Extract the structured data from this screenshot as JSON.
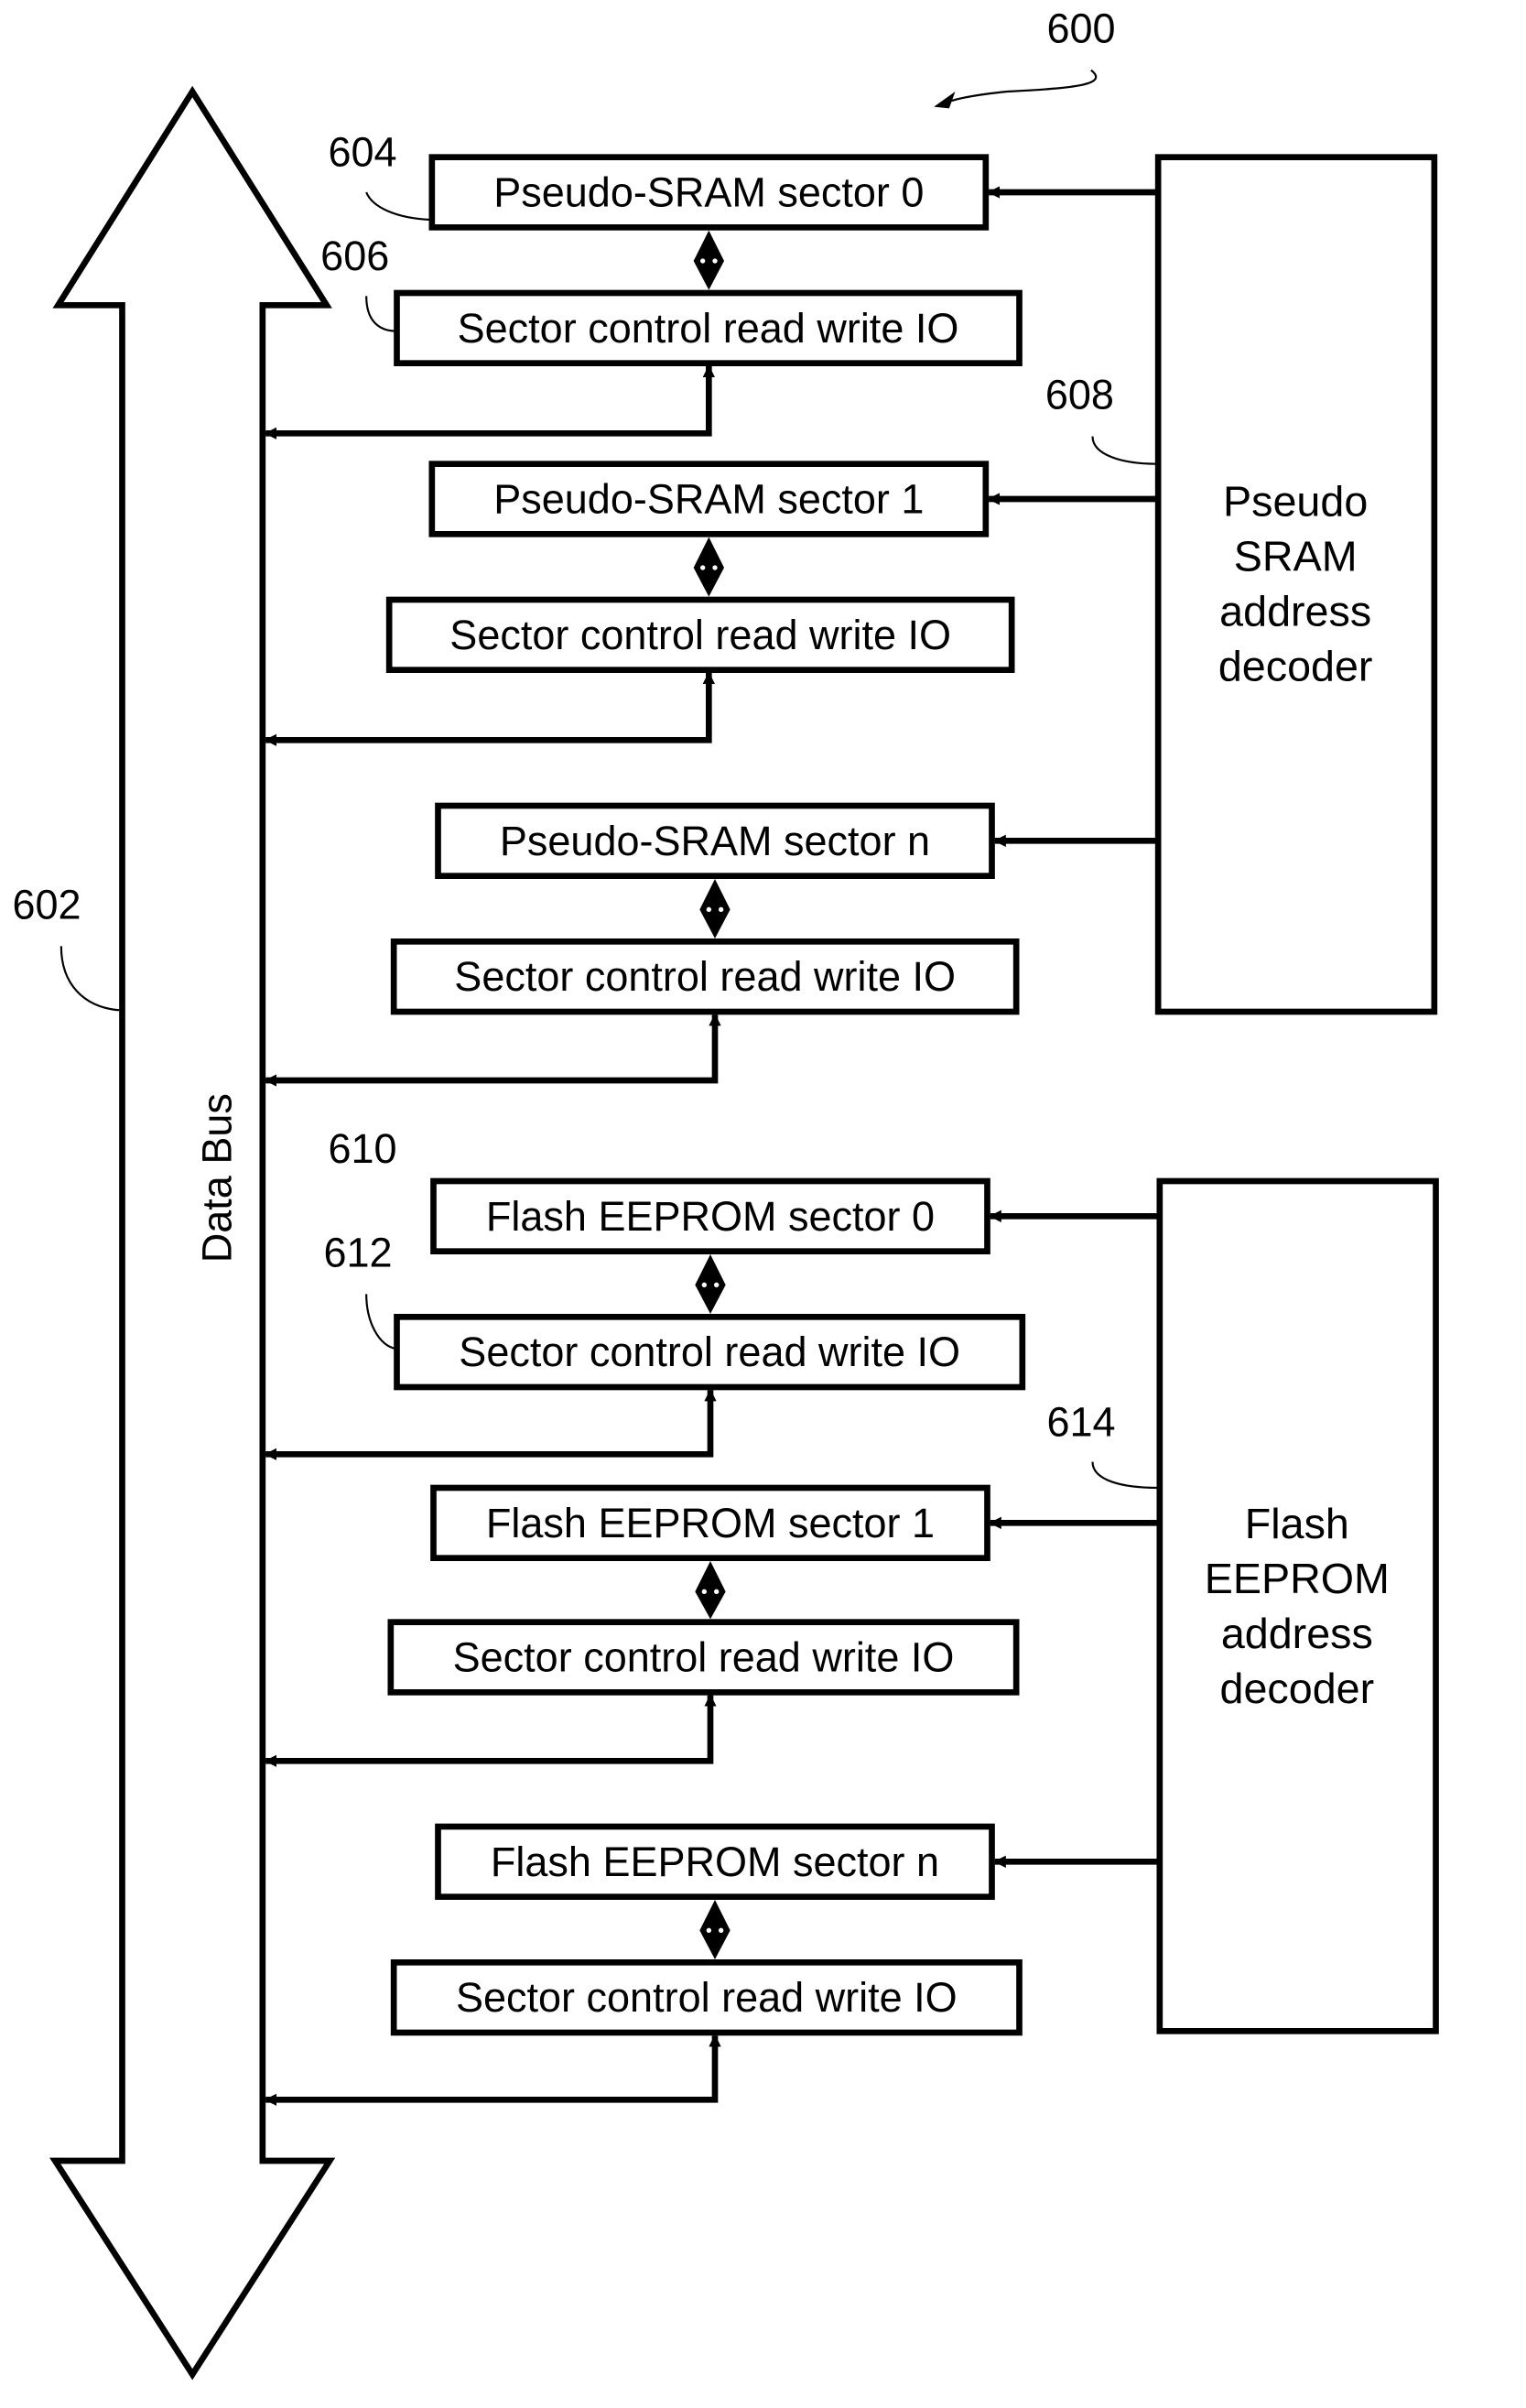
{
  "figure": {
    "reference": "600"
  },
  "data_bus": {
    "label": "Data Bus",
    "reference": "602"
  },
  "pseudo_sram": {
    "decoder": {
      "reference": "608",
      "lines": [
        "Pseudo",
        "SRAM",
        "address",
        "decoder"
      ]
    },
    "sectors": [
      {
        "name": "Pseudo-SRAM sector 0",
        "control": "Sector control read write IO",
        "sector_ref": "604",
        "control_ref": "606"
      },
      {
        "name": "Pseudo-SRAM sector 1",
        "control": "Sector control read write IO"
      },
      {
        "name": "Pseudo-SRAM sector n",
        "control": "Sector control read write IO"
      }
    ]
  },
  "flash_eeprom": {
    "decoder": {
      "reference": "614",
      "lines": [
        "Flash",
        "EEPROM",
        "address",
        "decoder"
      ]
    },
    "sectors": [
      {
        "name": "Flash EEPROM sector 0",
        "control": "Sector control read write IO",
        "sector_ref": "610",
        "control_ref": "612"
      },
      {
        "name": "Flash EEPROM sector 1",
        "control": "Sector control read write IO"
      },
      {
        "name": "Flash EEPROM sector n",
        "control": "Sector control read write IO"
      }
    ]
  }
}
